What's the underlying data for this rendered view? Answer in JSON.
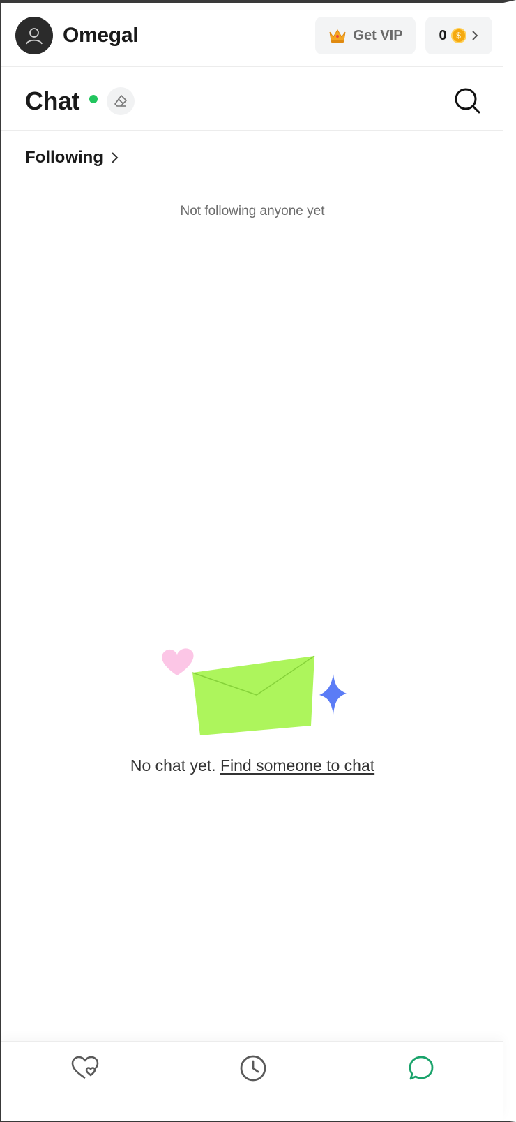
{
  "header": {
    "app_name": "Omegal",
    "vip_label": "Get VIP",
    "coin_count": "0",
    "coin_symbol": "$"
  },
  "chat_header": {
    "title": "Chat",
    "status": "online"
  },
  "following": {
    "label": "Following",
    "empty_text": "Not following anyone yet"
  },
  "empty_state": {
    "text": "No chat yet.",
    "link": "Find someone to chat"
  },
  "bottom_nav": {
    "items": [
      {
        "icon": "heart-icon",
        "active": false
      },
      {
        "icon": "clock-icon",
        "active": false
      },
      {
        "icon": "chat-bubble-icon",
        "active": true
      }
    ]
  },
  "colors": {
    "accent_green": "#22c55e",
    "nav_active": "#1aa36b",
    "nav_inactive": "#5a5a5a",
    "envelope": "#adf55c",
    "heart": "#fcc6e6",
    "sparkle": "#5b7cf6",
    "crown": "#f5a623",
    "coin": "#f5a90f"
  }
}
